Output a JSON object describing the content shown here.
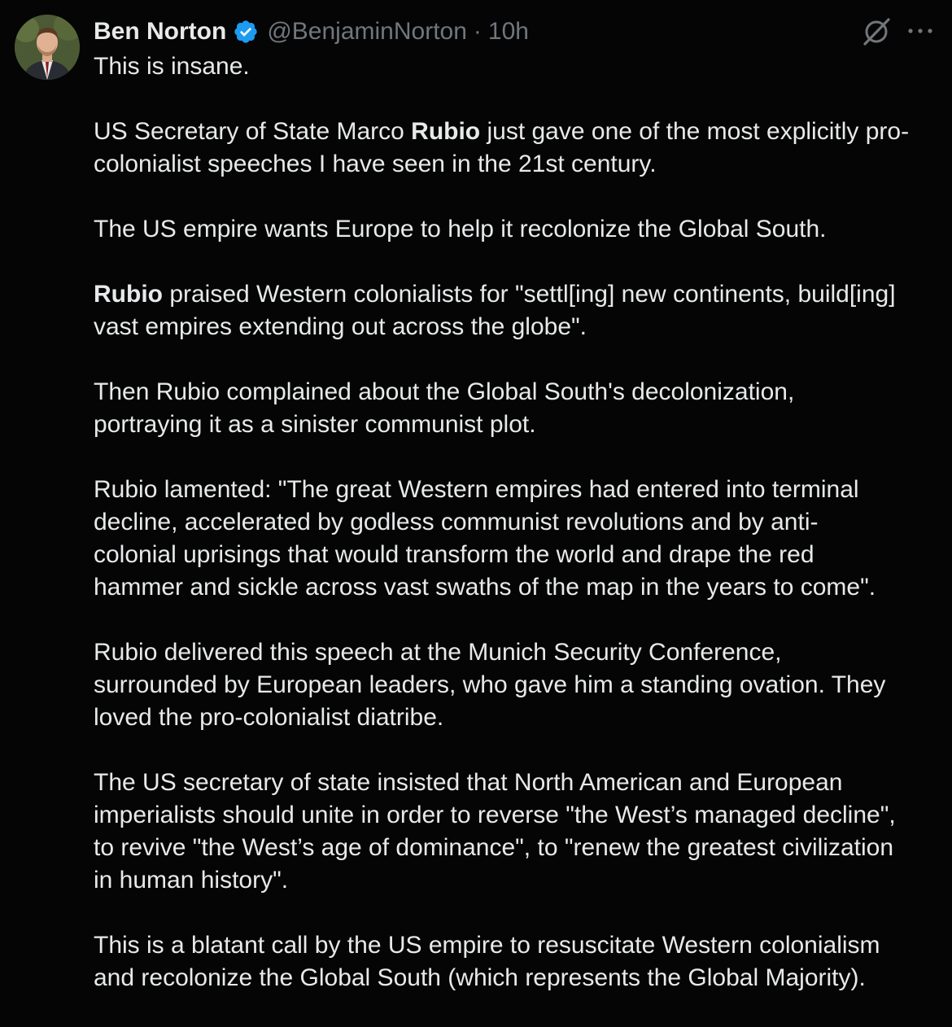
{
  "author": {
    "name": "Ben Norton",
    "handle": "@BenjaminNorton",
    "separator": "·",
    "time": "10h"
  },
  "icons": {
    "verified": "verified-badge-icon",
    "grok": "grok-icon",
    "more": "more-options-icon"
  },
  "colors": {
    "background": "#050505",
    "text": "#e7e9ea",
    "muted": "#71767b",
    "verified": "#1d9bf0"
  },
  "post": {
    "p1": "This is insane.",
    "p2_a": "US Secretary of State Marco ",
    "p2_b": "Rubio",
    "p2_c": " just gave one of the most explicitly pro-\ncolonialist speeches I have seen in the 21st century.",
    "p3": "The US empire wants Europe to help it recolonize the Global South.",
    "p4_a": "Rubio",
    "p4_b": " praised Western colonialists for \"settl[ing] new continents, build[ing]\nvast empires extending out across the globe\".",
    "p5": "Then Rubio complained about the Global South's decolonization,\nportraying it as a sinister communist plot.",
    "p6": "Rubio lamented: \"The great Western empires had entered into terminal\ndecline, accelerated by godless communist revolutions and by anti-\ncolonial uprisings that would transform the world and drape the red\nhammer and sickle across vast swaths of the map in the years to come\".",
    "p7": "Rubio delivered this speech at the Munich Security Conference,\nsurrounded by European leaders, who gave him a standing ovation. They\nloved the pro-colonialist diatribe.",
    "p8": "The US secretary of state insisted that North American and European\nimperialists should unite in order to reverse \"the West’s managed decline\",\nto revive \"the West’s age of dominance\", to \"renew the greatest civilization\nin human history\".",
    "p9": "This is a blatant call by the US empire to resuscitate Western colonialism\nand recolonize the Global South (which represents the Global Majority)."
  }
}
